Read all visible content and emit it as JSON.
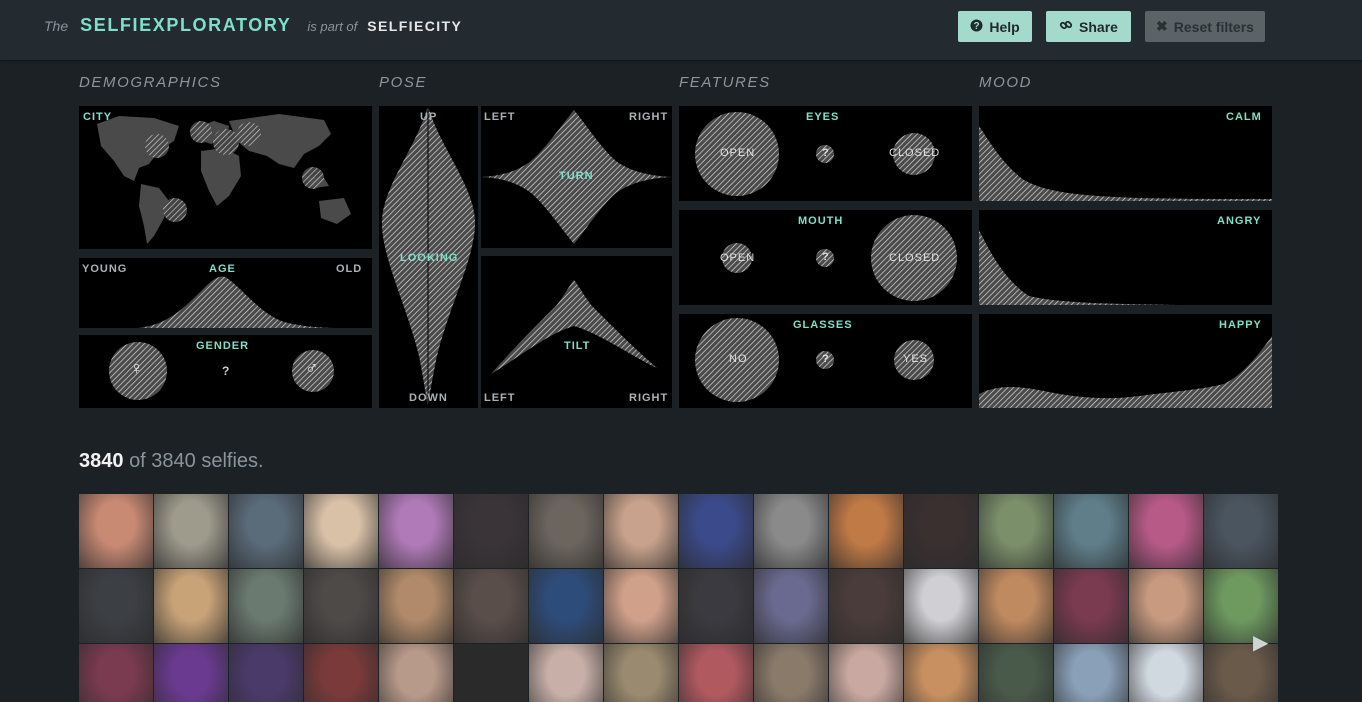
{
  "header": {
    "the": "The",
    "title": "SELFIEXPLORATORY",
    "part_of": "is part of",
    "parent": "SELFIECITY",
    "help_label": "Help",
    "share_label": "Share",
    "reset_label": "Reset filters"
  },
  "sections": {
    "demographics": "DEMOGRAPHICS",
    "pose": "POSE",
    "features": "FEATURES",
    "mood": "MOOD"
  },
  "demographics": {
    "city": "CITY",
    "age_young": "YOUNG",
    "age": "AGE",
    "age_old": "OLD",
    "gender": "GENDER",
    "female_symbol": "♀",
    "unknown": "?",
    "male_symbol": "♂"
  },
  "pose": {
    "up": "UP",
    "looking": "LOOKING",
    "down": "DOWN",
    "turn_left": "LEFT",
    "turn": "TURN",
    "turn_right": "RIGHT",
    "tilt_left": "LEFT",
    "tilt": "TILT",
    "tilt_right": "RIGHT"
  },
  "features": {
    "eyes": "EYES",
    "eyes_open": "OPEN",
    "eyes_unknown": "?",
    "eyes_closed": "CLOSED",
    "mouth": "MOUTH",
    "mouth_open": "OPEN",
    "mouth_unknown": "?",
    "mouth_closed": "CLOSED",
    "glasses": "GLASSES",
    "glasses_no": "NO",
    "glasses_unknown": "?",
    "glasses_yes": "YES"
  },
  "mood": {
    "calm": "CALM",
    "angry": "ANGRY",
    "happy": "HAPPY"
  },
  "results": {
    "shown": "3840",
    "of_text": "of 3840 selfies."
  },
  "colors": {
    "accent": "#7ee0c8",
    "button": "#a4dacb",
    "reset_button": "#5b6367",
    "panel": "#000000",
    "background": "#1c2126"
  },
  "thumbnails": [
    "#c98a74",
    "#9e9a8c",
    "#5a6b7a",
    "#d9c1a8",
    "#b07ab8",
    "#3a3438",
    "#6c655e",
    "#c8a28c",
    "#3b4a8a",
    "#8a8a8a",
    "#c07a46",
    "#3a3030",
    "#7a8f6a",
    "#5f7e8a",
    "#b85a88",
    "#4a5560",
    "#3c3f44",
    "#c9a378",
    "#6a7a70",
    "#4e4a48",
    "#b08a6a",
    "#5a4e4a",
    "#2e4c7a",
    "#d0a08a",
    "#3a3a40",
    "#6a6a90",
    "#4a3c3a",
    "#d0d0d4",
    "#c08a60",
    "#7a3a50",
    "#c89a80",
    "#6e9a60",
    "#7a3a50",
    "#6a3a90",
    "#4a3a6a",
    "#7a3a3a",
    "#b89a8a",
    "#2a2a2a",
    "#c8b0a8",
    "#9a8a70",
    "#b05a60",
    "#8a7a6a",
    "#c8a8a0",
    "#c89060",
    "#4a5a4a",
    "#8aa0b8",
    "#d0d8e0",
    "#6a5a4a"
  ]
}
